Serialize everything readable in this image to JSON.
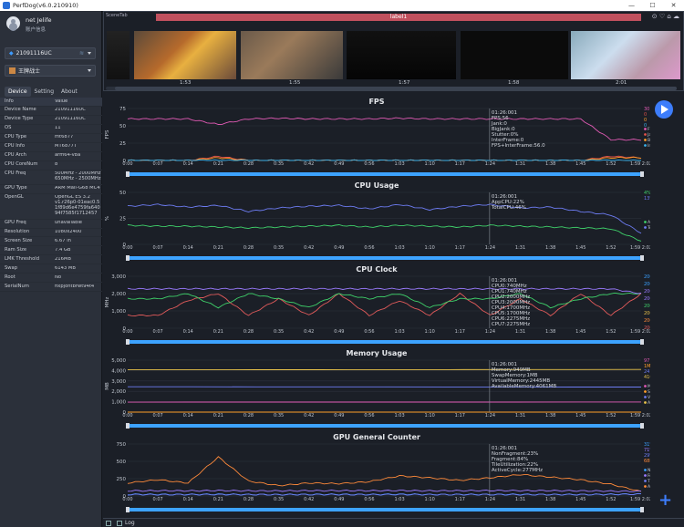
{
  "window": {
    "title": "PerfDog(v6.0.210910)"
  },
  "user": {
    "name": "net Jelife",
    "info_label": "账户信息"
  },
  "device_select": {
    "value": "21091116UC"
  },
  "app_select": {
    "value": "王牌战士"
  },
  "tabs": [
    "Device",
    "Setting",
    "About"
  ],
  "device_table": {
    "headers": [
      "Info",
      "Value"
    ],
    "rows": [
      {
        "k": "Device Name",
        "v": "21091116UC"
      },
      {
        "k": "Device Type",
        "v": "21091116UC"
      },
      {
        "k": "OS",
        "v": "11"
      },
      {
        "k": "CPU Type",
        "v": "mt6877"
      },
      {
        "k": "CPU Info",
        "v": "MT6877T"
      },
      {
        "k": "CPU Arch",
        "v": "arm64-v8a"
      },
      {
        "k": "CPU CoreNum",
        "v": "8"
      },
      {
        "k": "CPU Freq",
        "v": "500MHz - 2000MHz\n650MHz - 2500MHz"
      },
      {
        "k": "GPU Type",
        "v": "ARM Mali-G68 MC4"
      },
      {
        "k": "OpenGL",
        "v": "OpenGL ES 3.2\nv1.r26p0-01eac0.5\n1f89d6e4759fa640\n94f7585f1712457"
      },
      {
        "k": "GPU Freq",
        "v": "unavailable"
      },
      {
        "k": "Resolution",
        "v": "1080x2400"
      },
      {
        "k": "Screen Size",
        "v": "6.67 in"
      },
      {
        "k": "Ram Size",
        "v": "7.4 GB"
      },
      {
        "k": "LMK Threshold",
        "v": "216MB"
      },
      {
        "k": "Swap",
        "v": "6143 MB"
      },
      {
        "k": "Root",
        "v": "No"
      },
      {
        "k": "SerialNum",
        "v": "fixpjontbrwt94t4"
      }
    ]
  },
  "scene": {
    "label": "SceneTab",
    "bar_label": "label1",
    "thumb_times": [
      "1:53",
      "1:55",
      "1:57",
      "1:58",
      "2:01"
    ]
  },
  "x_ticks": [
    "0:00",
    "0:07",
    "0:14",
    "0:21",
    "0:28",
    "0:35",
    "0:42",
    "0:49",
    "0:56",
    "1:03",
    "1:10",
    "1:17",
    "1:24",
    "1:31",
    "1:38",
    "1:45",
    "1:52",
    "1:59 2:02"
  ],
  "panels": [
    {
      "title": "FPS",
      "ylabel": "FPS",
      "yticks": [
        "75",
        "50",
        "25",
        "0"
      ],
      "tooltip": [
        "01:26:001",
        "FPS:56",
        "Jank:0",
        "BigJank:0",
        "Stutter:0%",
        "InterFrame:0",
        "FPS+InterFrame:56.0"
      ],
      "legend_values": [
        {
          "t": "30",
          "c": "#e05ab4"
        },
        {
          "t": "0",
          "c": "#e0504a"
        },
        {
          "t": "0",
          "c": "#ff9f2a"
        },
        {
          "t": "0",
          "c": "#3ab0e8"
        }
      ],
      "legend": [
        {
          "t": "FPS",
          "c": "#e05ab4"
        },
        {
          "t": "Jank(卡顿次数)",
          "c": "#e0504a"
        },
        {
          "t": "BigJank(严重卡顿)",
          "c": "#ff9f2a"
        },
        {
          "t": "InterFrame",
          "c": "#3ab0e8"
        }
      ]
    },
    {
      "title": "CPU Usage",
      "ylabel": "%",
      "yticks": [
        "50",
        "25",
        "0"
      ],
      "tooltip": [
        "01:26:001",
        "AppCPU:22%",
        "TotalCPU:46%"
      ],
      "legend_values": [
        {
          "t": "4%",
          "c": "#3fd16a"
        },
        {
          "t": "13%",
          "c": "#6d7cf2"
        }
      ],
      "legend": [
        {
          "t": "AppCPU",
          "c": "#3fd16a"
        },
        {
          "t": "TotalCPU",
          "c": "#6d7cf2"
        }
      ]
    },
    {
      "title": "CPU Clock",
      "ylabel": "MHz",
      "yticks": [
        "3,000",
        "2,000",
        "1,000",
        "0"
      ],
      "tooltip": [
        "01:26:001",
        "CPU0:740MHz",
        "CPU1:740MHz",
        "CPU2:2000MHz",
        "CPU3:2000MHz",
        "CPU4:1700MHz",
        "CPU5:1700MHz",
        "CPU6:2275MHz",
        "CPU7:2275MHz"
      ],
      "legend_values": [
        {
          "t": "2000MHz",
          "c": "#3aa0ff"
        },
        {
          "t": "2000MHz",
          "c": "#3aa0ff"
        },
        {
          "t": "2000MHz",
          "c": "#9b7bff"
        },
        {
          "t": "2000MHz",
          "c": "#9b7bff"
        },
        {
          "t": "2000MHz",
          "c": "#3fd16a"
        },
        {
          "t": "2000MHz",
          "c": "#e8c24a"
        },
        {
          "t": "2000MHz",
          "c": "#ff8a3a"
        },
        {
          "t": "2000MHz",
          "c": "#e05a5a"
        }
      ],
      "legend": []
    },
    {
      "title": "Memory Usage",
      "ylabel": "MB",
      "yticks": [
        "5,000",
        "4,000",
        "3,000",
        "2,000",
        "1,000",
        "0"
      ],
      "tooltip": [
        "01:26:001",
        "Memory:949MB",
        "SwapMemory:1MB",
        "VirtualMemory:2445MB",
        "AvailableMemory:4061MB"
      ],
      "legend_values": [
        {
          "t": "971MB",
          "c": "#e05ab4"
        },
        {
          "t": "1MB",
          "c": "#ff9f2a"
        },
        {
          "t": "2413MB",
          "c": "#6d7cf2"
        },
        {
          "t": "4105MB",
          "c": "#e8c24a"
        }
      ],
      "legend": [
        {
          "t": "Memory",
          "c": "#e05ab4"
        },
        {
          "t": "SwapMemory",
          "c": "#ff9f2a"
        },
        {
          "t": "VirtualMemory",
          "c": "#6d7cf2"
        },
        {
          "t": "AvailableMe...",
          "c": "#e8c24a"
        }
      ]
    },
    {
      "title": "GPU General Counter",
      "ylabel": "",
      "yticks": [
        "750",
        "500",
        "250",
        "0"
      ],
      "tooltip": [
        "01:26:001",
        "NonFragment:23%",
        "Fragment:84%",
        "TileUtilization:22%",
        "ActiveCycle:277MHz"
      ],
      "legend_values": [
        {
          "t": "31%",
          "c": "#3aa0ff"
        },
        {
          "t": "71%",
          "c": "#9b7bff"
        },
        {
          "t": "29%",
          "c": "#6d7cf2"
        },
        {
          "t": "68MHz",
          "c": "#ff8a3a"
        }
      ],
      "legend": [
        {
          "t": "NonFragment",
          "c": "#3aa0ff"
        },
        {
          "t": "Fragment",
          "c": "#9b7bff"
        },
        {
          "t": "TileUtilization",
          "c": "#6d7cf2"
        },
        {
          "t": "ActiveCycle",
          "c": "#ff8a3a"
        }
      ]
    }
  ],
  "chart_data": [
    {
      "type": "line",
      "title": "FPS",
      "ylabel": "FPS",
      "ylim": [
        0,
        75
      ],
      "x": [
        "0:00",
        "0:07",
        "0:14",
        "0:21",
        "0:28",
        "0:35",
        "0:42",
        "0:49",
        "0:56",
        "1:03",
        "1:10",
        "1:17",
        "1:24",
        "1:31",
        "1:38",
        "1:45",
        "1:52",
        "1:59"
      ],
      "series": [
        {
          "name": "FPS",
          "values": [
            60,
            60,
            60,
            52,
            60,
            61,
            60,
            60,
            60,
            61,
            60,
            60,
            60,
            60,
            60,
            60,
            30,
            30
          ]
        },
        {
          "name": "Jank(卡顿次数)",
          "values": [
            0,
            0,
            0,
            6,
            0,
            0,
            0,
            0,
            0,
            0,
            0,
            0,
            0,
            0,
            0,
            0,
            6,
            4
          ]
        },
        {
          "name": "BigJank(严重卡顿)",
          "values": [
            0,
            0,
            0,
            4,
            0,
            0,
            0,
            0,
            0,
            0,
            0,
            0,
            0,
            0,
            0,
            0,
            4,
            4
          ]
        },
        {
          "name": "InterFrame",
          "values": [
            0,
            0,
            0,
            0,
            0,
            0,
            0,
            0,
            0,
            0,
            0,
            0,
            0,
            0,
            0,
            0,
            0,
            0
          ]
        }
      ]
    },
    {
      "type": "line",
      "title": "CPU Usage",
      "ylabel": "%",
      "ylim": [
        0,
        60
      ],
      "x": [
        "0:00",
        "0:07",
        "0:14",
        "0:21",
        "0:28",
        "0:35",
        "0:42",
        "0:49",
        "0:56",
        "1:03",
        "1:10",
        "1:17",
        "1:24",
        "1:31",
        "1:38",
        "1:45",
        "1:52",
        "1:59"
      ],
      "series": [
        {
          "name": "AppCPU",
          "values": [
            22,
            21,
            21,
            20,
            19,
            20,
            21,
            22,
            20,
            22,
            21,
            20,
            22,
            21,
            20,
            19,
            18,
            4
          ]
        },
        {
          "name": "TotalCPU",
          "values": [
            44,
            46,
            43,
            45,
            38,
            42,
            44,
            45,
            41,
            46,
            40,
            44,
            46,
            42,
            43,
            38,
            34,
            13
          ]
        }
      ]
    },
    {
      "type": "line",
      "title": "CPU Clock",
      "ylabel": "MHz",
      "ylim": [
        0,
        3000
      ],
      "x": [
        "0:00",
        "0:07",
        "0:14",
        "0:21",
        "0:28",
        "0:35",
        "0:42",
        "0:49",
        "0:56",
        "1:03",
        "1:10",
        "1:17",
        "1:24",
        "1:31",
        "1:38",
        "1:45",
        "1:52",
        "1:59"
      ],
      "series": [
        {
          "name": "CPU0-3",
          "values": [
            740,
            740,
            1600,
            2000,
            740,
            1700,
            740,
            2000,
            740,
            1600,
            740,
            2000,
            740,
            1700,
            740,
            2000,
            740,
            2000
          ]
        },
        {
          "name": "CPU4-5",
          "values": [
            1700,
            1700,
            2000,
            1200,
            2000,
            1700,
            1200,
            2000,
            1700,
            2000,
            1200,
            1700,
            1700,
            2000,
            1200,
            1700,
            2000,
            2000
          ]
        },
        {
          "name": "CPU6-7",
          "values": [
            2275,
            2275,
            2275,
            2275,
            2275,
            2275,
            2275,
            2275,
            2275,
            2275,
            2275,
            2275,
            2275,
            2275,
            2275,
            2275,
            2275,
            2000
          ]
        }
      ]
    },
    {
      "type": "line",
      "title": "Memory Usage",
      "ylabel": "MB",
      "ylim": [
        0,
        5000
      ],
      "x": [
        "0:00",
        "1:59"
      ],
      "series": [
        {
          "name": "Memory",
          "values": [
            960,
            971
          ]
        },
        {
          "name": "SwapMemory",
          "values": [
            1,
            1
          ]
        },
        {
          "name": "VirtualMemory",
          "values": [
            2440,
            2413
          ]
        },
        {
          "name": "AvailableMemory",
          "values": [
            4070,
            4105
          ]
        }
      ]
    },
    {
      "type": "line",
      "title": "GPU General Counter",
      "ylim": [
        0,
        800
      ],
      "x": [
        "0:00",
        "0:07",
        "0:14",
        "0:21",
        "0:28",
        "0:35",
        "0:42",
        "0:49",
        "0:56",
        "1:03",
        "1:10",
        "1:17",
        "1:24",
        "1:31",
        "1:38",
        "1:45",
        "1:52",
        "1:59"
      ],
      "series": [
        {
          "name": "ActiveCycle",
          "values": [
            200,
            250,
            200,
            600,
            230,
            160,
            200,
            190,
            220,
            310,
            280,
            240,
            280,
            330,
            290,
            250,
            180,
            68
          ]
        },
        {
          "name": "Fragment",
          "values": [
            80,
            82,
            80,
            84,
            80,
            79,
            82,
            83,
            81,
            84,
            80,
            82,
            84,
            83,
            82,
            80,
            75,
            71
          ]
        },
        {
          "name": "NonFragment",
          "values": [
            25,
            24,
            23,
            26,
            22,
            21,
            24,
            25,
            23,
            26,
            22,
            23,
            23,
            24,
            22,
            23,
            25,
            31
          ]
        },
        {
          "name": "TileUtilization",
          "values": [
            22,
            21,
            22,
            23,
            22,
            21,
            22,
            22,
            21,
            23,
            22,
            22,
            22,
            21,
            22,
            22,
            24,
            29
          ]
        }
      ]
    }
  ],
  "log": {
    "label": "Log"
  }
}
